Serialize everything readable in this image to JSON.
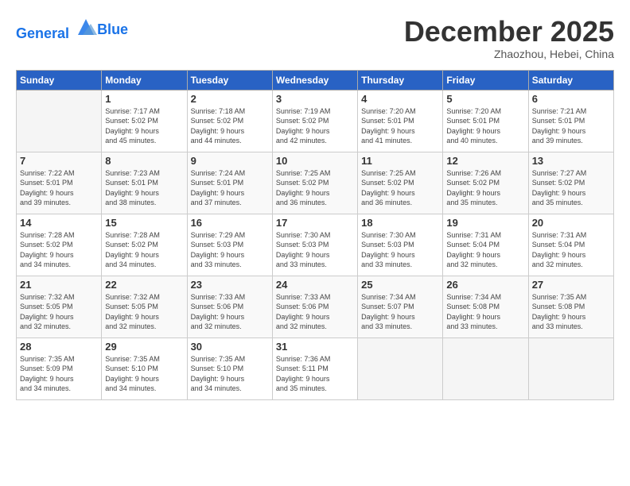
{
  "header": {
    "logo_line1": "General",
    "logo_line2": "Blue",
    "month": "December 2025",
    "location": "Zhaozhou, Hebei, China"
  },
  "weekdays": [
    "Sunday",
    "Monday",
    "Tuesday",
    "Wednesday",
    "Thursday",
    "Friday",
    "Saturday"
  ],
  "weeks": [
    [
      {
        "day": "",
        "info": ""
      },
      {
        "day": "1",
        "info": "Sunrise: 7:17 AM\nSunset: 5:02 PM\nDaylight: 9 hours\nand 45 minutes."
      },
      {
        "day": "2",
        "info": "Sunrise: 7:18 AM\nSunset: 5:02 PM\nDaylight: 9 hours\nand 44 minutes."
      },
      {
        "day": "3",
        "info": "Sunrise: 7:19 AM\nSunset: 5:02 PM\nDaylight: 9 hours\nand 42 minutes."
      },
      {
        "day": "4",
        "info": "Sunrise: 7:20 AM\nSunset: 5:01 PM\nDaylight: 9 hours\nand 41 minutes."
      },
      {
        "day": "5",
        "info": "Sunrise: 7:20 AM\nSunset: 5:01 PM\nDaylight: 9 hours\nand 40 minutes."
      },
      {
        "day": "6",
        "info": "Sunrise: 7:21 AM\nSunset: 5:01 PM\nDaylight: 9 hours\nand 39 minutes."
      }
    ],
    [
      {
        "day": "7",
        "info": "Sunrise: 7:22 AM\nSunset: 5:01 PM\nDaylight: 9 hours\nand 39 minutes."
      },
      {
        "day": "8",
        "info": "Sunrise: 7:23 AM\nSunset: 5:01 PM\nDaylight: 9 hours\nand 38 minutes."
      },
      {
        "day": "9",
        "info": "Sunrise: 7:24 AM\nSunset: 5:01 PM\nDaylight: 9 hours\nand 37 minutes."
      },
      {
        "day": "10",
        "info": "Sunrise: 7:25 AM\nSunset: 5:02 PM\nDaylight: 9 hours\nand 36 minutes."
      },
      {
        "day": "11",
        "info": "Sunrise: 7:25 AM\nSunset: 5:02 PM\nDaylight: 9 hours\nand 36 minutes."
      },
      {
        "day": "12",
        "info": "Sunrise: 7:26 AM\nSunset: 5:02 PM\nDaylight: 9 hours\nand 35 minutes."
      },
      {
        "day": "13",
        "info": "Sunrise: 7:27 AM\nSunset: 5:02 PM\nDaylight: 9 hours\nand 35 minutes."
      }
    ],
    [
      {
        "day": "14",
        "info": "Sunrise: 7:28 AM\nSunset: 5:02 PM\nDaylight: 9 hours\nand 34 minutes."
      },
      {
        "day": "15",
        "info": "Sunrise: 7:28 AM\nSunset: 5:02 PM\nDaylight: 9 hours\nand 34 minutes."
      },
      {
        "day": "16",
        "info": "Sunrise: 7:29 AM\nSunset: 5:03 PM\nDaylight: 9 hours\nand 33 minutes."
      },
      {
        "day": "17",
        "info": "Sunrise: 7:30 AM\nSunset: 5:03 PM\nDaylight: 9 hours\nand 33 minutes."
      },
      {
        "day": "18",
        "info": "Sunrise: 7:30 AM\nSunset: 5:03 PM\nDaylight: 9 hours\nand 33 minutes."
      },
      {
        "day": "19",
        "info": "Sunrise: 7:31 AM\nSunset: 5:04 PM\nDaylight: 9 hours\nand 32 minutes."
      },
      {
        "day": "20",
        "info": "Sunrise: 7:31 AM\nSunset: 5:04 PM\nDaylight: 9 hours\nand 32 minutes."
      }
    ],
    [
      {
        "day": "21",
        "info": "Sunrise: 7:32 AM\nSunset: 5:05 PM\nDaylight: 9 hours\nand 32 minutes."
      },
      {
        "day": "22",
        "info": "Sunrise: 7:32 AM\nSunset: 5:05 PM\nDaylight: 9 hours\nand 32 minutes."
      },
      {
        "day": "23",
        "info": "Sunrise: 7:33 AM\nSunset: 5:06 PM\nDaylight: 9 hours\nand 32 minutes."
      },
      {
        "day": "24",
        "info": "Sunrise: 7:33 AM\nSunset: 5:06 PM\nDaylight: 9 hours\nand 32 minutes."
      },
      {
        "day": "25",
        "info": "Sunrise: 7:34 AM\nSunset: 5:07 PM\nDaylight: 9 hours\nand 33 minutes."
      },
      {
        "day": "26",
        "info": "Sunrise: 7:34 AM\nSunset: 5:08 PM\nDaylight: 9 hours\nand 33 minutes."
      },
      {
        "day": "27",
        "info": "Sunrise: 7:35 AM\nSunset: 5:08 PM\nDaylight: 9 hours\nand 33 minutes."
      }
    ],
    [
      {
        "day": "28",
        "info": "Sunrise: 7:35 AM\nSunset: 5:09 PM\nDaylight: 9 hours\nand 34 minutes."
      },
      {
        "day": "29",
        "info": "Sunrise: 7:35 AM\nSunset: 5:10 PM\nDaylight: 9 hours\nand 34 minutes."
      },
      {
        "day": "30",
        "info": "Sunrise: 7:35 AM\nSunset: 5:10 PM\nDaylight: 9 hours\nand 34 minutes."
      },
      {
        "day": "31",
        "info": "Sunrise: 7:36 AM\nSunset: 5:11 PM\nDaylight: 9 hours\nand 35 minutes."
      },
      {
        "day": "",
        "info": ""
      },
      {
        "day": "",
        "info": ""
      },
      {
        "day": "",
        "info": ""
      }
    ]
  ]
}
